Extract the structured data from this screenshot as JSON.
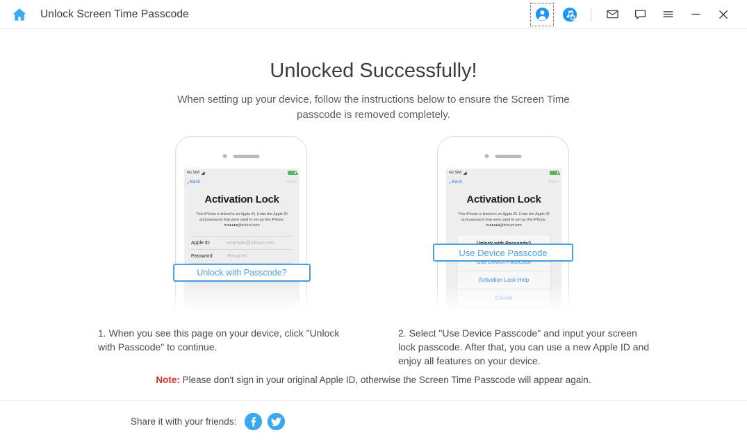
{
  "titlebar": {
    "home_icon": "home-icon",
    "title": "Unlock Screen Time Passcode",
    "buttons": [
      {
        "name": "account-button",
        "icon": "user-avatar-icon"
      },
      {
        "name": "music-search-button",
        "icon": "music-note-search-icon"
      },
      {
        "name": "mail-button",
        "icon": "envelope-icon",
        "glyph": "✉"
      },
      {
        "name": "feedback-button",
        "icon": "speech-bubble-icon",
        "glyph": "🗨"
      },
      {
        "name": "menu-button",
        "icon": "hamburger-menu-icon",
        "glyph": "≡"
      },
      {
        "name": "minimize-button",
        "icon": "minimize-icon",
        "glyph": "—"
      },
      {
        "name": "close-button",
        "icon": "close-icon",
        "glyph": "✕"
      }
    ]
  },
  "main": {
    "heading": "Unlocked Successfully!",
    "subheading": "When setting up your device, follow the instructions below to ensure the Screen Time passcode is removed completely.",
    "phone_left": {
      "status": {
        "carrier": "No SIM",
        "wifi": "wifi-icon",
        "battery": "battery-icon"
      },
      "nav": {
        "back": "Back",
        "next": "Next"
      },
      "screen_title": "Activation Lock",
      "screen_desc_before": "This iPhone is linked to an Apple ID. Enter the Apple ID and password that were used to set up this iPhone. m",
      "screen_desc_dots": "●●●●●",
      "screen_desc_after": "@icloud.com",
      "fields": [
        {
          "label": "Apple ID",
          "placeholder": "example@icloud.com"
        },
        {
          "label": "Password",
          "placeholder": "Required"
        }
      ],
      "callout": "Unlock with Passcode?"
    },
    "phone_right": {
      "status": {
        "carrier": "No SIM",
        "wifi": "wifi-icon",
        "battery": "battery-icon"
      },
      "nav": {
        "back": "Back",
        "next": "Next"
      },
      "screen_title": "Activation Lock",
      "screen_desc_before": "This iPhone is linked to an Apple ID. Enter the Apple ID and password that were used to set up this iPhone. m",
      "screen_desc_dots": "●●●●●",
      "screen_desc_after": "@icloud.com",
      "sheet": {
        "title": "Unlock with Passcode?",
        "items": [
          "Use Device Passcode",
          "Activation Lock Help",
          "Cancel"
        ]
      },
      "callout": "Use Device Passcode"
    },
    "caption_1": "1. When you see this page on your device, click \"Unlock with Passcode\" to continue.",
    "caption_2": "2. Select \"Use Device Passcode\" and input your screen lock passcode. After that, you can use a new Apple ID and enjoy all features on your device.",
    "note_label": "Note:",
    "note_text": " Please don't sign in your original Apple ID, otherwise the Screen Time Passcode will appear again."
  },
  "footer": {
    "share_label": "Share it with your friends:",
    "facebook_icon": "facebook-icon",
    "twitter_icon": "twitter-icon"
  },
  "colors": {
    "accent_blue": "#4a9fe0",
    "icon_blue": "#3ba9f0",
    "note_red": "#d93025",
    "ios_link": "#3c8ce0",
    "battery_green": "#5ab45a"
  }
}
